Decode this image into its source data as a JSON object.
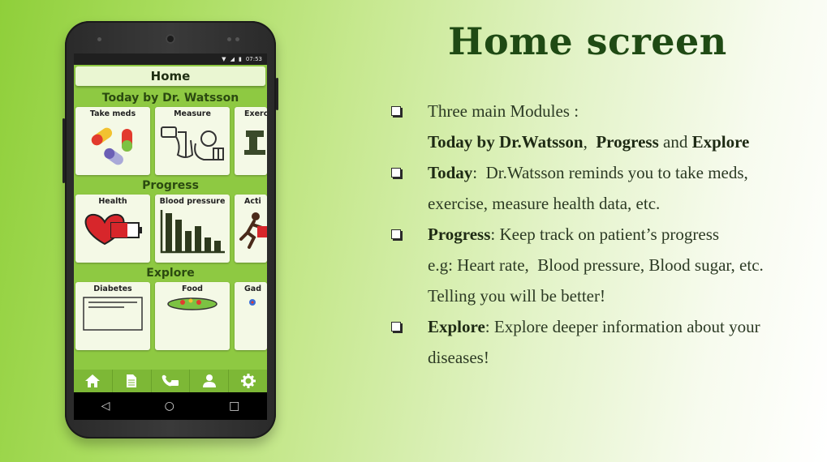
{
  "slide": {
    "title": "Home screen",
    "bullets": [
      {
        "lines": [
          {
            "parts": [
              {
                "text": "Three main Modules :",
                "bold": false
              }
            ]
          },
          {
            "parts": [
              {
                "text": "Today by Dr.Watsson",
                "bold": true
              },
              {
                "text": ",  ",
                "bold": false
              },
              {
                "text": "Progress",
                "bold": true
              },
              {
                "text": " and ",
                "bold": false
              },
              {
                "text": "Explore",
                "bold": true
              }
            ]
          }
        ]
      },
      {
        "lines": [
          {
            "parts": [
              {
                "text": "Today",
                "bold": true
              },
              {
                "text": ":  Dr.Watsson reminds you to take meds,",
                "bold": false
              }
            ]
          },
          {
            "parts": [
              {
                "text": "exercise, measure health data, etc.",
                "bold": false
              }
            ]
          }
        ]
      },
      {
        "lines": [
          {
            "parts": [
              {
                "text": "Progress",
                "bold": true
              },
              {
                "text": ": Keep track on patient’s progress",
                "bold": false
              }
            ]
          },
          {
            "parts": [
              {
                "text": "e.g: Heart rate,  Blood pressure, Blood sugar, etc.",
                "bold": false
              }
            ]
          },
          {
            "parts": [
              {
                "text": "Telling you will be better!",
                "bold": false
              }
            ]
          }
        ]
      },
      {
        "lines": [
          {
            "parts": [
              {
                "text": "Explore",
                "bold": true
              },
              {
                "text": ": Explore deeper information about your",
                "bold": false
              }
            ]
          },
          {
            "parts": [
              {
                "text": "diseases!",
                "bold": false
              }
            ]
          }
        ]
      }
    ]
  },
  "phone": {
    "status_time": "07:53",
    "header_title": "Home",
    "sections": [
      {
        "title": "Today by Dr. Watsson",
        "tiles": [
          {
            "label": "Take meds",
            "icon": "pills-icon"
          },
          {
            "label": "Measure",
            "icon": "measure-device-icon"
          },
          {
            "label": "Exerc",
            "icon": "exercise-icon"
          }
        ]
      },
      {
        "title": "Progress",
        "tiles": [
          {
            "label": "Health",
            "icon": "heart-battery-icon"
          },
          {
            "label": "Blood pressure",
            "icon": "bar-chart-icon"
          },
          {
            "label": "Acti",
            "icon": "running-person-icon"
          }
        ]
      },
      {
        "title": "Explore",
        "tiles": [
          {
            "label": "Diabetes",
            "icon": "newspaper-icon"
          },
          {
            "label": "Food",
            "icon": "food-bowl-icon"
          },
          {
            "label": "Gad",
            "icon": "gadget-icon"
          }
        ]
      }
    ],
    "bottom_nav": [
      "home-icon",
      "document-icon",
      "phone-chat-icon",
      "person-icon",
      "gear-icon"
    ],
    "system_nav": [
      "back-icon",
      "home-circle-icon",
      "recents-icon"
    ],
    "colors": {
      "accent_green": "#8ec942",
      "header_bg": "#eaf6d2",
      "title_green": "#1f4a14"
    }
  }
}
